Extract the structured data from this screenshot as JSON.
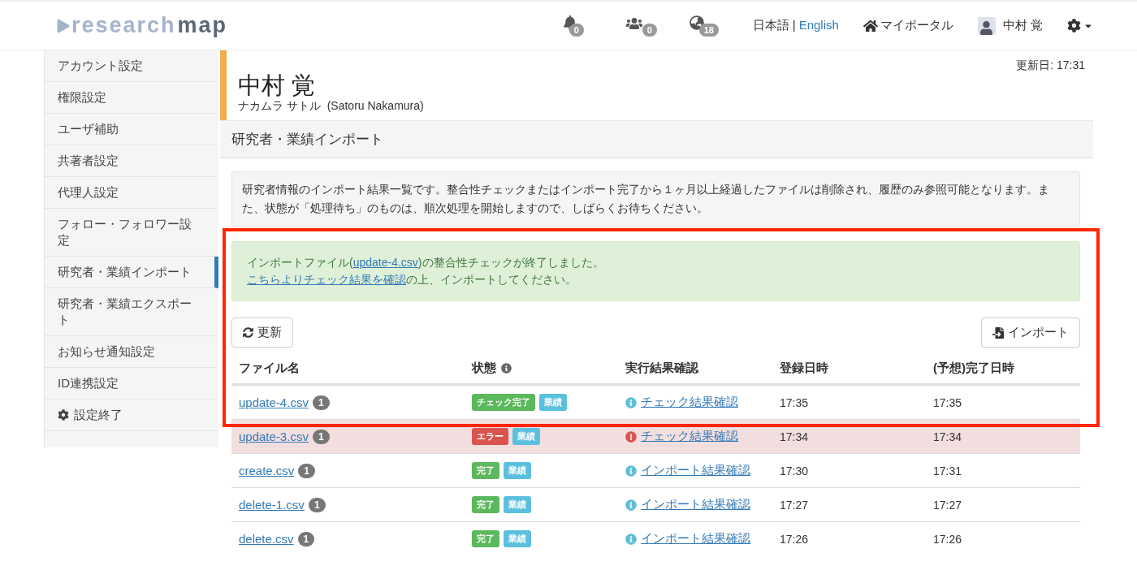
{
  "header": {
    "logo": {
      "light": "research",
      "dark": "map"
    },
    "notifications": [
      {
        "kind": "bell",
        "count": "0"
      },
      {
        "kind": "users",
        "count": "0"
      },
      {
        "kind": "globe",
        "count": "18"
      }
    ],
    "language": {
      "current": "日本語",
      "separator": "|",
      "other": "English"
    },
    "portal": "マイポータル",
    "user": "中村 覚"
  },
  "sidebar": {
    "items": [
      {
        "label": "アカウント設定",
        "selected": false,
        "kind": "link"
      },
      {
        "label": "権限設定",
        "selected": false,
        "kind": "link"
      },
      {
        "label": "ユーザ補助",
        "selected": false,
        "kind": "link"
      },
      {
        "label": "共著者設定",
        "selected": false,
        "kind": "link"
      },
      {
        "label": "代理人設定",
        "selected": false,
        "kind": "link"
      },
      {
        "label": "フォロー・フォロワー設定",
        "selected": false,
        "kind": "link"
      },
      {
        "label": "研究者・業績インポート",
        "selected": true,
        "kind": "link"
      },
      {
        "label": "研究者・業績エクスポート",
        "selected": false,
        "kind": "link"
      },
      {
        "label": "お知らせ通知設定",
        "selected": false,
        "kind": "link"
      },
      {
        "label": "ID連携設定",
        "selected": false,
        "kind": "link"
      },
      {
        "label": "設定終了",
        "selected": false,
        "kind": "exit"
      }
    ]
  },
  "profile": {
    "updated": "更新日: 17:31",
    "name": "中村 覚",
    "kana": "ナカムラ サトル",
    "roman": "(Satoru Nakamura)"
  },
  "section_title": "研究者・業績インポート",
  "info": "研究者情報のインポート結果一覧です。整合性チェックまたはインポート完了から１ヶ月以上経過したファイルは削除され、履歴のみ参照可能となります。また、状態が「処理待ち」のものは、順次処理を開始しますので、しばらくお待ちください。",
  "highlight_frame": true,
  "alert": {
    "line1_before": "インポートファイル(",
    "line1_link": "update-4.csv",
    "line1_after": ")の整合性チェックが終了しました。",
    "line2_link": "こちらよりチェック結果を確認",
    "line2_after": "の上、インポートしてください。"
  },
  "toolbar": {
    "refresh": "更新",
    "import": "インポート"
  },
  "table": {
    "columns": [
      "ファイル名",
      "状態",
      "実行結果確認",
      "登録日時",
      "(予想)完了日時"
    ],
    "rows": [
      {
        "file": "update-4.csv",
        "count": "1",
        "status": {
          "label": "チェック完了",
          "color": "#5cb85c"
        },
        "tag": "業績",
        "result": "チェック結果確認",
        "error": false,
        "registered": "17:35",
        "completed": "17:35"
      },
      {
        "file": "update-3.csv",
        "count": "1",
        "status": {
          "label": "エラー",
          "color": "#d9534f"
        },
        "tag": "業績",
        "result": "チェック結果確認",
        "error": true,
        "registered": "17:34",
        "completed": "17:34"
      },
      {
        "file": "create.csv",
        "count": "1",
        "status": {
          "label": "完了",
          "color": "#5cb85c"
        },
        "tag": "業績",
        "result": "インポート結果確認",
        "error": false,
        "registered": "17:30",
        "completed": "17:31"
      },
      {
        "file": "delete-1.csv",
        "count": "1",
        "status": {
          "label": "完了",
          "color": "#5cb85c"
        },
        "tag": "業績",
        "result": "インポート結果確認",
        "error": false,
        "registered": "17:27",
        "completed": "17:27"
      },
      {
        "file": "delete.csv",
        "count": "1",
        "status": {
          "label": "完了",
          "color": "#5cb85c"
        },
        "tag": "業績",
        "result": "インポート結果確認",
        "error": false,
        "registered": "17:26",
        "completed": "17:26"
      }
    ]
  }
}
